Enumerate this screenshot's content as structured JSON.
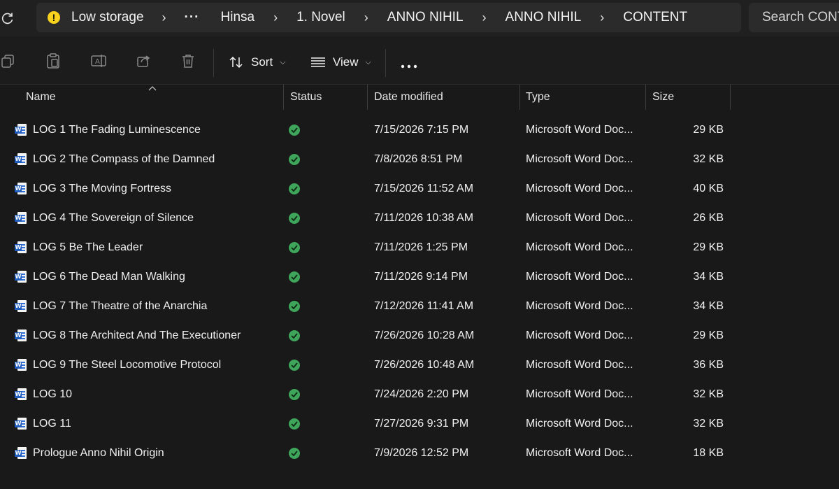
{
  "address": {
    "warning_text": "Low storage",
    "overflow": "···",
    "crumbs": [
      "Hinsa",
      "1. Novel",
      "ANNO NIHIL",
      "ANNO NIHIL",
      "CONTENT"
    ],
    "search_placeholder": "Search CONTENT"
  },
  "toolbar": {
    "sort_label": "Sort",
    "view_label": "View",
    "icons": [
      "copy-icon",
      "paste-icon",
      "rename-icon",
      "share-icon",
      "delete-icon",
      "more-icon"
    ]
  },
  "columns": {
    "name": "Name",
    "status": "Status",
    "date": "Date modified",
    "type": "Type",
    "size": "Size"
  },
  "files": [
    {
      "name": "LOG 1 The Fading Luminescence",
      "date": "7/15/2026 7:15 PM",
      "type": "Microsoft Word Doc...",
      "size": "29 KB"
    },
    {
      "name": "LOG 2 The Compass of the Damned",
      "date": "7/8/2026 8:51 PM",
      "type": "Microsoft Word Doc...",
      "size": "32 KB"
    },
    {
      "name": "LOG 3 The Moving Fortress",
      "date": "7/15/2026 11:52 AM",
      "type": "Microsoft Word Doc...",
      "size": "40 KB"
    },
    {
      "name": "LOG 4 The Sovereign of Silence",
      "date": "7/11/2026 10:38 AM",
      "type": "Microsoft Word Doc...",
      "size": "26 KB"
    },
    {
      "name": "LOG 5 Be The Leader",
      "date": "7/11/2026 1:25 PM",
      "type": "Microsoft Word Doc...",
      "size": "29 KB"
    },
    {
      "name": "LOG 6 The Dead Man Walking",
      "date": "7/11/2026 9:14 PM",
      "type": "Microsoft Word Doc...",
      "size": "34 KB"
    },
    {
      "name": "LOG 7 The Theatre of the Anarchia",
      "date": "7/12/2026 11:41 AM",
      "type": "Microsoft Word Doc...",
      "size": "34 KB"
    },
    {
      "name": "LOG 8 The Architect And The Executioner",
      "date": "7/26/2026 10:28 AM",
      "type": "Microsoft Word Doc...",
      "size": "29 KB"
    },
    {
      "name": "LOG 9 The Steel Locomotive Protocol",
      "date": "7/26/2026 10:48 AM",
      "type": "Microsoft Word Doc...",
      "size": "36 KB"
    },
    {
      "name": "LOG 10",
      "date": "7/24/2026 2:20 PM",
      "type": "Microsoft Word Doc...",
      "size": "32 KB"
    },
    {
      "name": "LOG 11",
      "date": "7/27/2026 9:31 PM",
      "type": "Microsoft Word Doc...",
      "size": "32 KB"
    },
    {
      "name": "Prologue Anno Nihil Origin",
      "date": "7/9/2026 12:52 PM",
      "type": "Microsoft Word Doc...",
      "size": "18 KB"
    }
  ],
  "colors": {
    "background": "#191919",
    "breadcrumb_bg": "#2b2b2b",
    "status_ok": "#3ea55b",
    "word_blue": "#1f5dbf",
    "warning": "#f8d21c"
  }
}
